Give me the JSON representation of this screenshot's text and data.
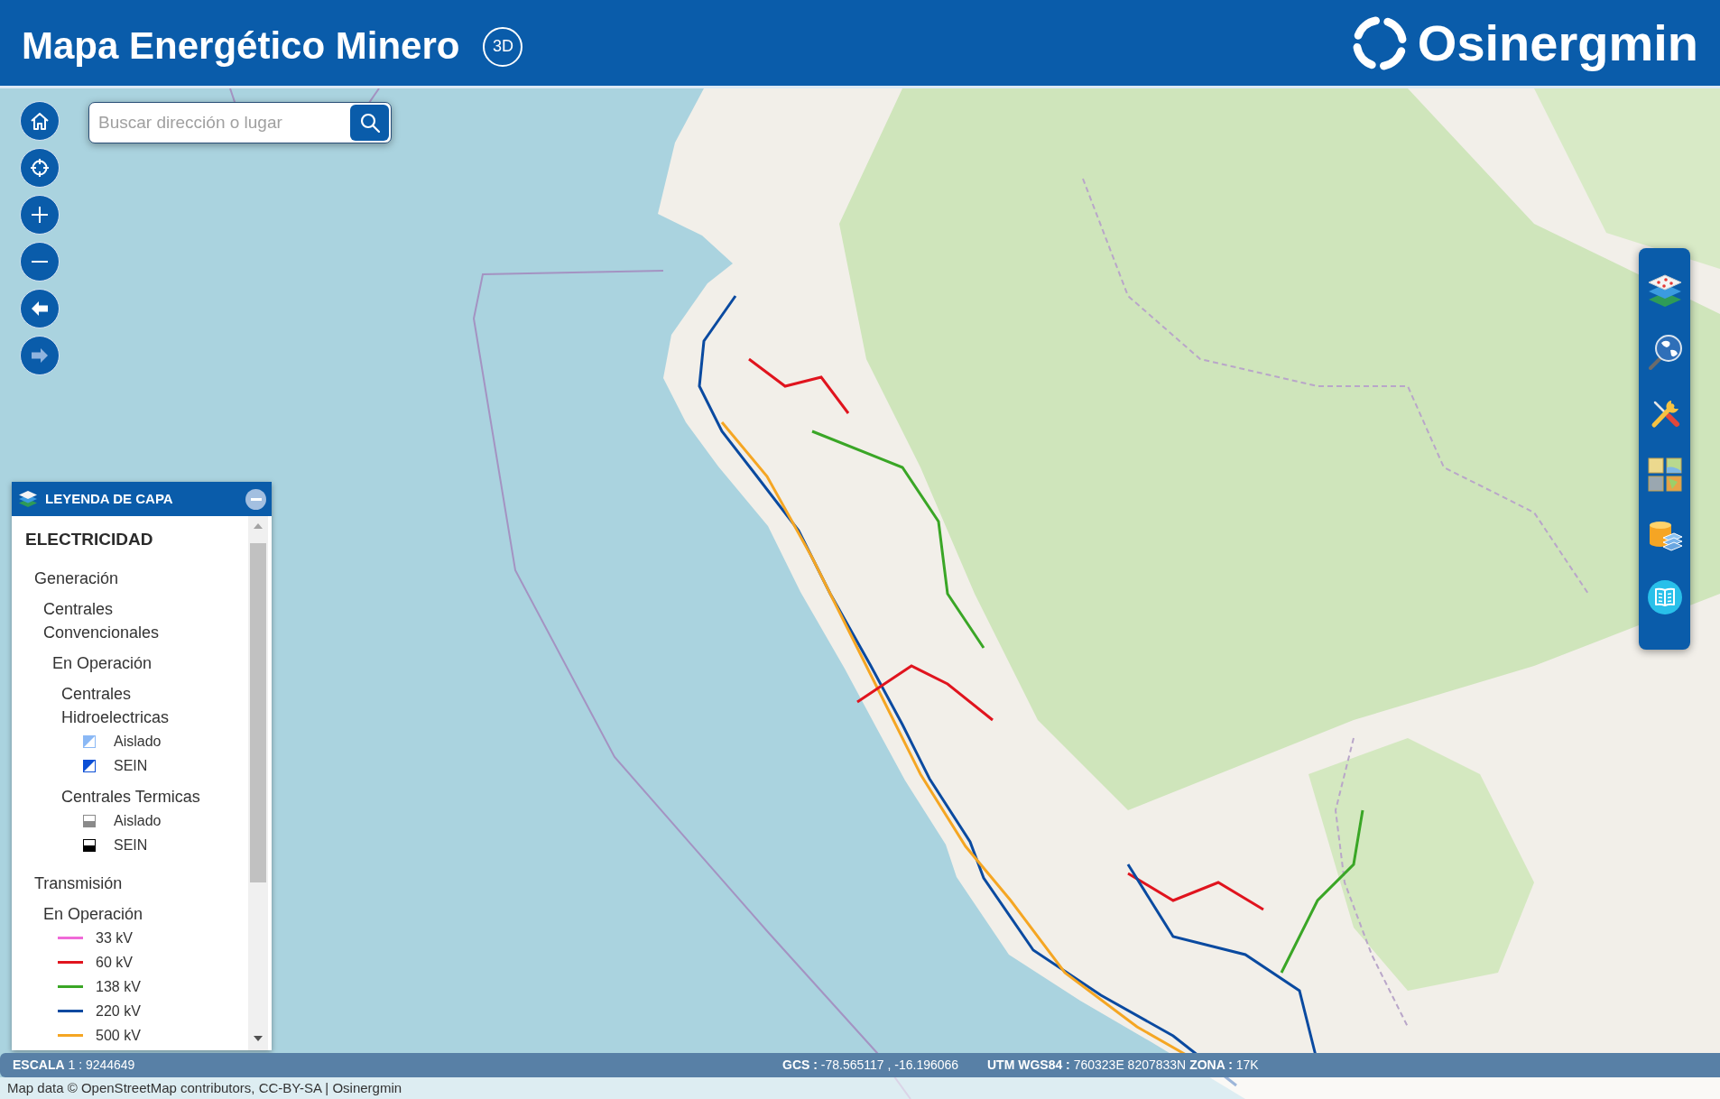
{
  "header": {
    "title": "Mapa Energético Minero",
    "view_toggle": "3D",
    "logo_text": "Osinergmin"
  },
  "map_controls": [
    {
      "kind": "home",
      "disabled": false
    },
    {
      "kind": "locate",
      "disabled": false
    },
    {
      "kind": "zoomin",
      "disabled": false
    },
    {
      "kind": "zoomout",
      "disabled": false
    },
    {
      "kind": "back",
      "disabled": false
    },
    {
      "kind": "forward",
      "disabled": true
    }
  ],
  "search": {
    "placeholder": "Buscar dirección o lugar"
  },
  "legend": {
    "title": "LEYENDA DE CAPA",
    "expanded": true,
    "items": [
      {
        "label": "ELECTRICIDAD",
        "children": [
          {
            "label": "Generación",
            "children": [
              {
                "label": "Centrales Convencionales",
                "children": [
                  {
                    "label": "En Operación",
                    "children": [
                      {
                        "label": "Centrales Hidroelectricas",
                        "children": [
                          {
                            "label": "Aislado",
                            "kind": "hydro",
                            "color": "#8ab8f5"
                          },
                          {
                            "label": "SEIN",
                            "kind": "hydro",
                            "color": "#0b4fd6"
                          }
                        ]
                      },
                      {
                        "label": "Centrales Termicas",
                        "children": [
                          {
                            "label": "Aislado",
                            "kind": "thermal",
                            "color": "#8a8a8a"
                          },
                          {
                            "label": "SEIN",
                            "kind": "thermal",
                            "color": "#000000"
                          }
                        ]
                      }
                    ]
                  }
                ]
              }
            ]
          },
          {
            "label": "Transmisión",
            "children": [
              {
                "label": "En Operación",
                "children": [
                  {
                    "label": "33 kV",
                    "kind": "line",
                    "color": "#f06ad8"
                  },
                  {
                    "label": "60 kV",
                    "kind": "line",
                    "color": "#e0141e"
                  },
                  {
                    "label": "138 kV",
                    "kind": "line",
                    "color": "#3aa626"
                  },
                  {
                    "label": "220 kV",
                    "kind": "line",
                    "color": "#0a4aa0"
                  },
                  {
                    "label": "500 kV",
                    "kind": "line",
                    "color": "#f5a623"
                  }
                ]
              }
            ]
          }
        ]
      }
    ]
  },
  "status_bar": {
    "scale": "**ESCALA** 1 : 9244649",
    "gcs": "**GCS :** -78.565117 , -16.196066",
    "utm": "**UTM WGS84 :** 760323E 8207833N **ZONA :** 17K"
  },
  "attribution": "Map data © OpenStreetMap contributors, CC-BY-SA | Osinergmin"
}
